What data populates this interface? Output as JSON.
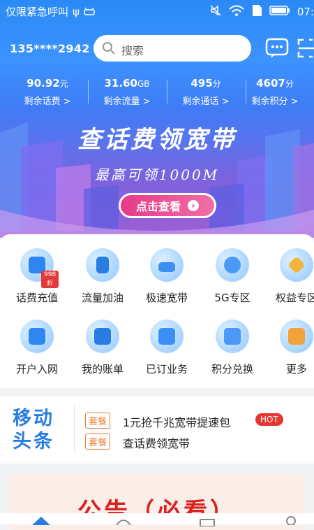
{
  "status_bar": {
    "carrier_text": "仅限紧急呼叫",
    "time": "07:"
  },
  "header": {
    "phone": "135****2942",
    "search_placeholder": "搜索"
  },
  "stats": [
    {
      "value": "90.92",
      "unit": "元",
      "label": "剩余话费 >"
    },
    {
      "value": "31.60",
      "unit": "GB",
      "label": "剩余流量 >"
    },
    {
      "value": "495",
      "unit": "分",
      "label": "剩余通话 >"
    },
    {
      "value": "4607",
      "unit": "分",
      "label": "剩余积分 >"
    }
  ],
  "banner": {
    "title": "查话费领宽带",
    "subtitle": "最高可领1000M",
    "button": "点击查看"
  },
  "services": [
    {
      "label": "话费充值",
      "icon": "wallet-icon",
      "badge": "998折"
    },
    {
      "label": "流量加油",
      "icon": "phone-data-icon"
    },
    {
      "label": "极速宽带",
      "icon": "router-icon"
    },
    {
      "label": "5G专区",
      "icon": "5g-icon"
    },
    {
      "label": "权益专区",
      "icon": "diamond-icon"
    },
    {
      "label": "开户入网",
      "icon": "sim-card-icon"
    },
    {
      "label": "我的账单",
      "icon": "bill-icon"
    },
    {
      "label": "已订业务",
      "icon": "subscription-icon"
    },
    {
      "label": "积分兑换",
      "icon": "points-shop-icon"
    },
    {
      "label": "更多",
      "icon": "more-icon"
    }
  ],
  "news": {
    "logo_line1": "移动",
    "logo_line2": "头条",
    "items": [
      {
        "tag": "套餐",
        "text": "1元抢千兆宽带提速包",
        "badge": "HOT"
      },
      {
        "tag": "套餐",
        "text": "查话费领宽带"
      }
    ]
  },
  "notice": {
    "text": "公告（必看）"
  },
  "colors": {
    "primary": "#2a8af5",
    "accent": "#e8398a",
    "tag_orange": "#f27a2a",
    "hot_red": "#e6362e"
  }
}
